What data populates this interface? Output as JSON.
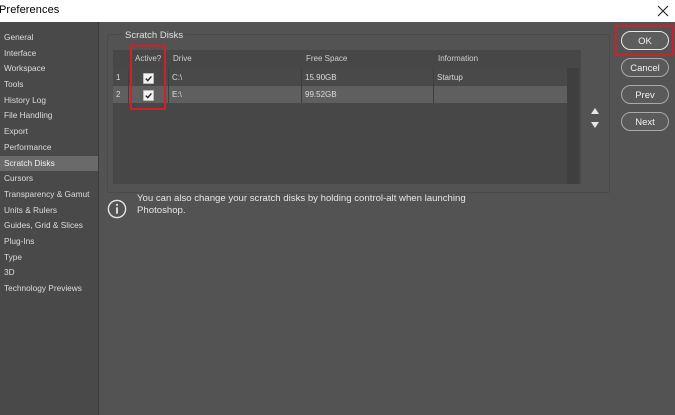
{
  "window": {
    "title": "Preferences"
  },
  "sidebar": {
    "items": [
      {
        "label": "General"
      },
      {
        "label": "Interface"
      },
      {
        "label": "Workspace"
      },
      {
        "label": "Tools"
      },
      {
        "label": "History Log"
      },
      {
        "label": "File Handling"
      },
      {
        "label": "Export"
      },
      {
        "label": "Performance"
      },
      {
        "label": "Scratch Disks"
      },
      {
        "label": "Cursors"
      },
      {
        "label": "Transparency & Gamut"
      },
      {
        "label": "Units & Rulers"
      },
      {
        "label": "Guides, Grid & Slices"
      },
      {
        "label": "Plug-Ins"
      },
      {
        "label": "Type"
      },
      {
        "label": "3D"
      },
      {
        "label": "Technology Previews"
      }
    ],
    "selected": "Scratch Disks"
  },
  "scratch": {
    "title": "Scratch Disks",
    "headers": {
      "active": "Active?",
      "drive": "Drive",
      "free": "Free Space",
      "info": "Information"
    },
    "rows": [
      {
        "num": "1",
        "active": true,
        "drive": "C:\\",
        "free": "15.90GB",
        "info": "Startup"
      },
      {
        "num": "2",
        "active": true,
        "drive": "E:\\",
        "free": "99.52GB",
        "info": ""
      }
    ]
  },
  "buttons": {
    "ok": "OK",
    "cancel": "Cancel",
    "prev": "Prev",
    "next": "Next"
  },
  "note": "You can also change your scratch disks by holding control-alt when launching Photoshop.",
  "colors": {
    "highlight": "#d0202a",
    "panel": "#535353",
    "selected_row": "#5f5f5f"
  }
}
